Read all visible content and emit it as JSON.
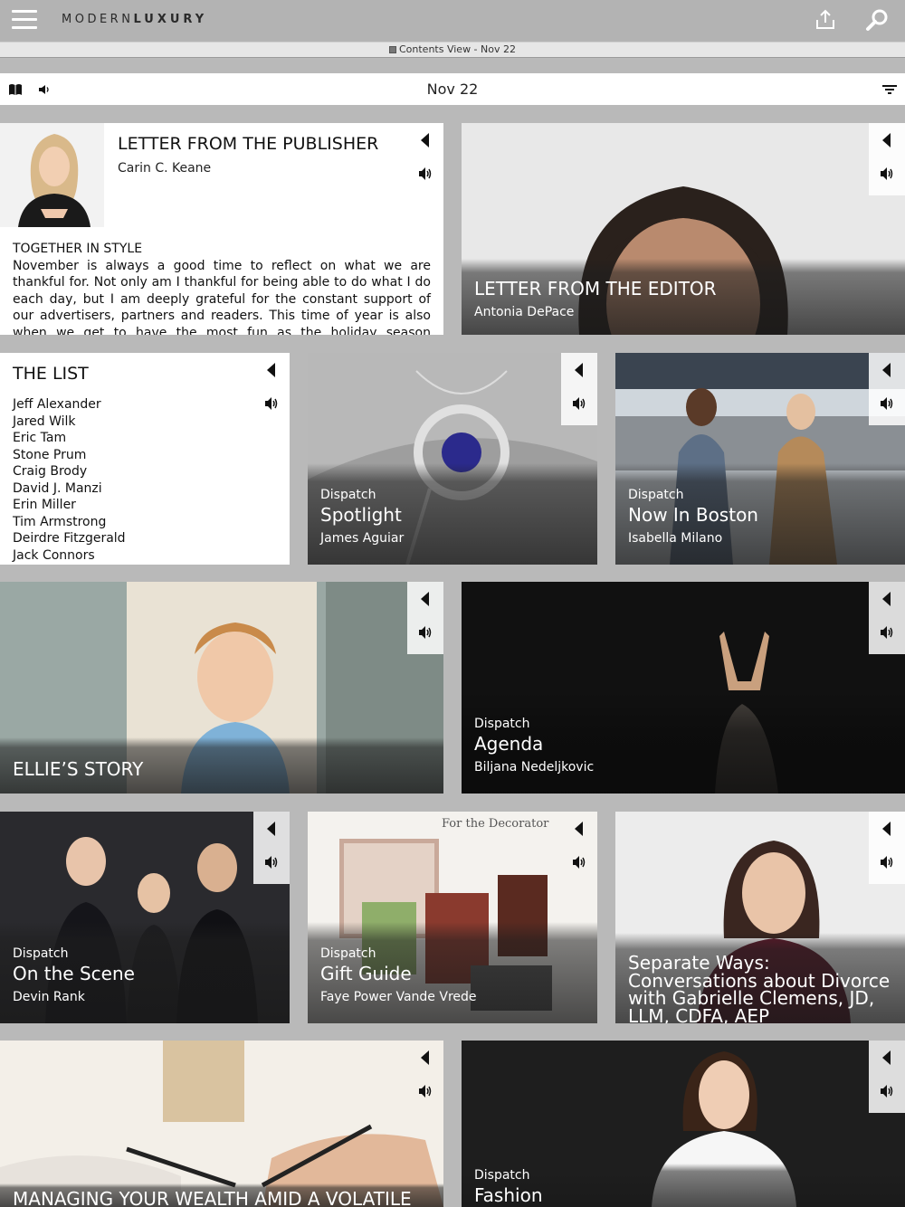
{
  "header": {
    "logo_light": "MODERN",
    "logo_bold": "LUXURY",
    "menu_icon": "hamburger-icon",
    "share_icon": "share-icon",
    "search_icon": "search-icon"
  },
  "subbar": {
    "label": "Contents View - Nov 22"
  },
  "toolbar": {
    "date": "Nov 22",
    "book_icon": "book-icon",
    "speaker_icon": "speaker-icon",
    "filter_icon": "filter-icon"
  },
  "cards": {
    "publisher": {
      "title": "LETTER FROM THE PUBLISHER",
      "author": "Carin C. Keane",
      "subhead": "TOGETHER IN STYLE",
      "body": "November is always a good time to reflect on what we are thankful for. Not only am I thankful for being able to do what I do each day, but I am deeply grateful for the constant support of our advertisers, partners and readers. This time of year is also when we get to have the most fun as the holiday season approaches and events are"
    },
    "editor": {
      "title": "LETTER FROM THE EDITOR",
      "author": "Antonia DePace"
    },
    "the_list": {
      "title": "THE LIST",
      "items": [
        "Jeff Alexander",
        "Jared Wilk",
        "Eric Tam",
        "Stone Prum",
        "Craig Brody",
        "David J. Manzi",
        "Erin Miller",
        "Tim Armstrong",
        "Deirdre Fitzgerald",
        "Jack Connors"
      ]
    },
    "spotlight": {
      "kicker": "Dispatch",
      "title": "Spotlight",
      "author": "James Aguiar"
    },
    "now_in_boston": {
      "kicker": "Dispatch",
      "title": "Now In Boston",
      "author": "Isabella Milano"
    },
    "ellies_story": {
      "title": "ELLIE’S STORY"
    },
    "agenda": {
      "kicker": "Dispatch",
      "title": "Agenda",
      "author": "Biljana Nedeljkovic"
    },
    "on_the_scene": {
      "kicker": "Dispatch",
      "title": "On the Scene",
      "author": "Devin Rank"
    },
    "gift_guide": {
      "kicker": "Dispatch",
      "title": "Gift Guide",
      "author": "Faye Power Vande Vrede",
      "photo_caption": "For the Decorator"
    },
    "separate_ways": {
      "title": "Separate Ways: Conversations about Divorce with Gabrielle Clemens, JD, LLM, CDFA, AEP"
    },
    "wealth": {
      "title": "MANAGING YOUR WEALTH AMID A VOLATILE"
    },
    "fashion": {
      "kicker": "Dispatch",
      "title": "Fashion"
    }
  },
  "colors": {
    "page_bg": "#b9b9b9",
    "topbar_bg": "#b3b3b3",
    "card_white": "#ffffff",
    "overlay_text": "#ffffff"
  },
  "card_icons": {
    "play": "play-icon",
    "audio": "audio-icon"
  }
}
